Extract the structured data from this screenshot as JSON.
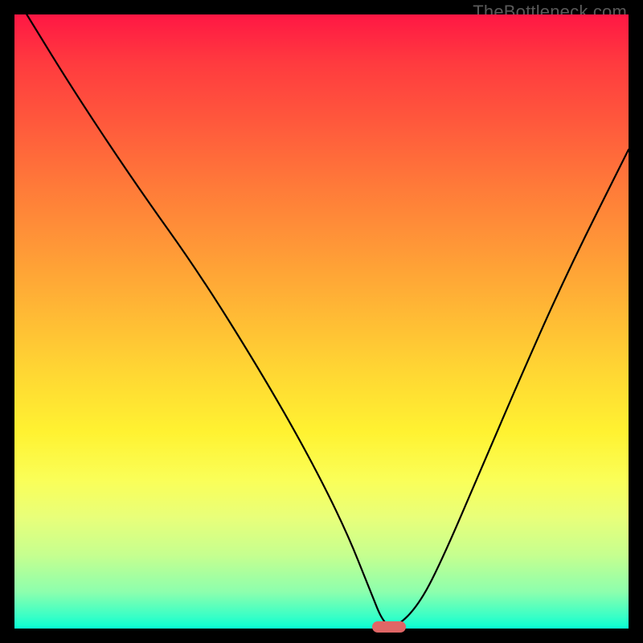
{
  "watermark": "TheBottleneck.com",
  "chart_data": {
    "type": "line",
    "title": "",
    "xlabel": "",
    "ylabel": "",
    "xlim": [
      0,
      100
    ],
    "ylim": [
      0,
      100
    ],
    "series": [
      {
        "name": "bottleneck-curve",
        "x": [
          2,
          10,
          20,
          30,
          40,
          48,
          54,
          58,
          60,
          62,
          66,
          70,
          76,
          82,
          90,
          100
        ],
        "values": [
          100,
          87,
          72,
          58,
          42,
          28,
          16,
          6,
          1,
          0,
          4,
          12,
          26,
          40,
          58,
          78
        ]
      }
    ],
    "marker": {
      "x": 61,
      "y": 0,
      "color": "#e06666"
    },
    "background_gradient": [
      "#ff1744",
      "#ff7a39",
      "#ffd633",
      "#faff59",
      "#39ffc6"
    ]
  }
}
